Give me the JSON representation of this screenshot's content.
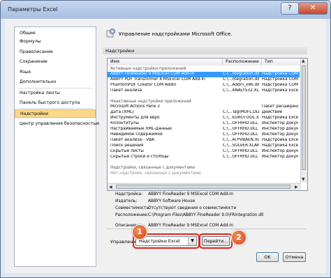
{
  "window": {
    "title": "Параметры Excel",
    "help": "?",
    "close": "✕"
  },
  "sidebar": {
    "items": [
      {
        "label": "Общие"
      },
      {
        "label": "Формулы"
      },
      {
        "label": "Правописание"
      },
      {
        "label": "Сохранение"
      },
      {
        "label": "Язык"
      },
      {
        "label": "Дополнительно"
      },
      {
        "label": "Настройка ленты"
      },
      {
        "label": "Панель быстрого доступа"
      },
      {
        "label": "Надстройки",
        "active": true
      },
      {
        "label": "Центр управления безопасностью"
      }
    ]
  },
  "header": {
    "text": "Управление надстройками Microsoft Office."
  },
  "section": {
    "title": "Надстройки"
  },
  "table": {
    "headers": [
      "Имя",
      "Расположение",
      "Тип"
    ],
    "groups": [
      {
        "title": "Активные надстройки приложений",
        "rows": [
          [
            "ABBYY FineReader 9 MSExcel COM Add-In",
            "C:\\...ntegration.dll",
            "Надстройка COM"
          ],
          [
            "ABBYY PDF Transformer 4 MSExcel COM Add-In",
            "C:\\...ntegration.dll",
            "Надстройка COM"
          ],
          [
            "PhantomPDF Creator COM Addin",
            "C:\\...Addin_x86.dll",
            "Надстройка COM"
          ],
          [
            "Пакет анализа",
            "C:\\...ANALYS32.XLL",
            "Надстройка Excel"
          ]
        ]
      },
      {
        "title": "Неактивные надстройки приложений",
        "rows": [
          [
            "Microsoft Actions Pane 3",
            "",
            "Пакет расширения"
          ],
          [
            "Дата (XML)",
            "C:\\...Tag\\MOFL.DLL",
            "Действие"
          ],
          [
            "Инструменты для евро",
            "C:\\...EUROTOOL.XLAM",
            "Надстройка Excel"
          ],
          [
            "Колонтитулы",
            "C:\\...OFFRHD.DLL",
            "Инспектор докум"
          ],
          [
            "Настраиваемые XML-данные",
            "C:\\...OFFRHD.DLL",
            "Инспектор докум"
          ],
          [
            "Невидимое содержимое",
            "C:\\...OFFRHD.DLL",
            "Инспектор докум"
          ],
          [
            "Пакет анализа - VBA",
            "C:\\...ATPVBAEN.XLAM",
            "Надстройка Excel"
          ],
          [
            "Поиск решения",
            "C:\\...SOLVER.XLAM",
            "Надстройка Excel"
          ],
          [
            "Скрытые листы",
            "C:\\...OFFRHD.DLL",
            "Инспектор докум"
          ],
          [
            "Скрытые строки и столбцы",
            "C:\\...OFFRHD.DLL",
            "Инспектор докум"
          ]
        ]
      },
      {
        "title": "Надстройки, связанные с документами",
        "rows": [],
        "note": "Нет надстроек, связанных с документами"
      }
    ]
  },
  "details": [
    {
      "label": "Надстройка:",
      "value": "ABBYY FineReader 9 MSExcel COM Add-In"
    },
    {
      "label": "Издатель:",
      "value": "ABBYY Software House"
    },
    {
      "label": "Совместимость:",
      "value": "Отсутствуют сведения о совместимости"
    },
    {
      "label": "Расположение:",
      "value": "C:\\Program Files\\ABBYY FineReader 9.0\\FRIntegration.dll"
    },
    {
      "label": "Описание:",
      "value": "ABBYY FineReader 9 MSExcel COM Add-In"
    }
  ],
  "manage": {
    "label": "Управление:",
    "selected": "Надстройки Excel",
    "go": "Перейти..."
  },
  "badges": [
    "1",
    "2"
  ],
  "buttons": {
    "ok": "OK",
    "cancel": "Отмена"
  },
  "colors": {
    "highlight": "#e2231a",
    "badge": "#e06030",
    "selected_nav": "#fbd88a",
    "selected_row": "#3399ff"
  }
}
